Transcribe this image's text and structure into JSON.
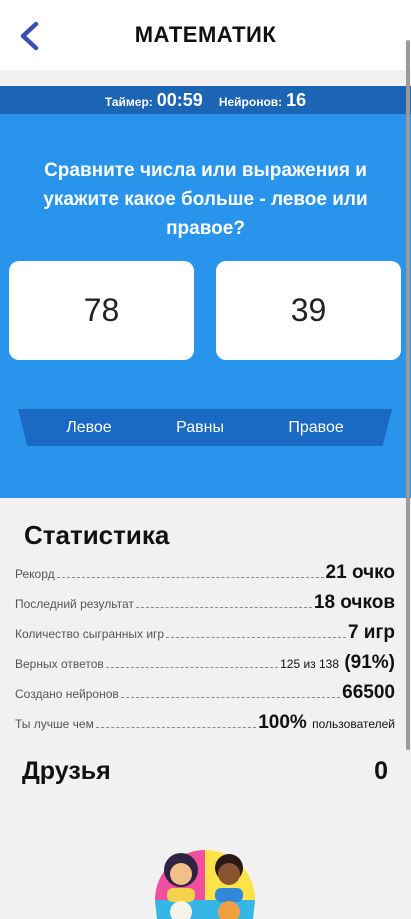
{
  "header": {
    "title": "МАТЕМАТИК",
    "back_icon": "chevron-left-icon",
    "accent": "#3b4fb3"
  },
  "status": {
    "timer_label": "Таймер:",
    "timer_value": "00:59",
    "neurons_label": "Нейронов:",
    "neurons_value": "16"
  },
  "game": {
    "question": "Сравните числа или выражения и укажите какое больше - левое или правое?",
    "left_value": "78",
    "right_value": "39",
    "answers": {
      "left": "Левое",
      "equal": "Равны",
      "right": "Правое"
    },
    "background": "#2894ec"
  },
  "stats": {
    "title": "Статистика",
    "rows": [
      {
        "label": "Рекорд",
        "value": "21 очко"
      },
      {
        "label": "Последний результат",
        "value": "18 очков"
      },
      {
        "label": "Количество сыгранных игр",
        "value": "7 игр"
      },
      {
        "label": "Верных ответов",
        "value_small": "125 из 138",
        "value": "(91%)"
      },
      {
        "label": "Создано нейронов",
        "value": "66500"
      },
      {
        "label": "Ты лучше чем",
        "value": "100%",
        "value_suffix": "пользователей"
      }
    ]
  },
  "friends": {
    "label": "Друзья",
    "count": "0"
  }
}
